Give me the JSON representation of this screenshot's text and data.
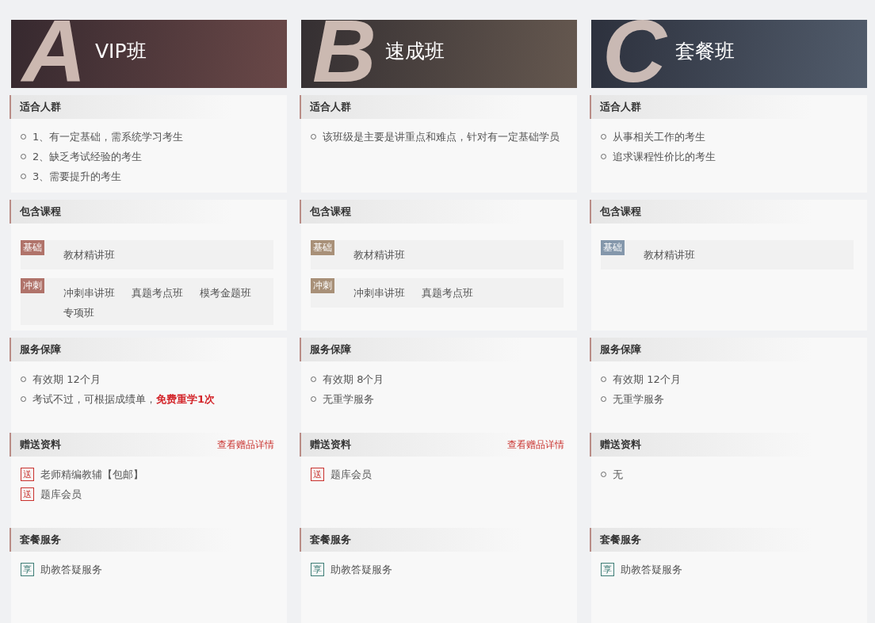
{
  "plans": [
    {
      "letter": "A",
      "title": "VIP班",
      "color": "#b0736a",
      "audience": {
        "heading": "适合人群",
        "items": [
          "1、有一定基础，需系统学习考生",
          "2、缺乏考试经验的考生",
          "3、需要提升的考生"
        ]
      },
      "courses": {
        "heading": "包含课程",
        "groups": [
          {
            "tag": "基础",
            "courses": [
              "教材精讲班"
            ]
          },
          {
            "tag": "冲刺",
            "courses": [
              "冲刺串讲班",
              "真题考点班",
              "模考金题班",
              "专项班"
            ]
          }
        ]
      },
      "service": {
        "heading": "服务保障",
        "items": [
          "有效期 12个月",
          "考试不过，可根据成绩单，**免费重学1次**"
        ]
      },
      "gifts": {
        "heading": "赠送资料",
        "link": "查看赠品详情",
        "items": [
          {
            "kind": "gift",
            "badge": "送",
            "text": "老师精编教辅【包邮】"
          },
          {
            "kind": "gift",
            "badge": "送",
            "text": "题库会员"
          }
        ]
      },
      "package": {
        "heading": "套餐服务",
        "items": [
          {
            "kind": "share",
            "badge": "享",
            "text": "助教答疑服务"
          }
        ]
      }
    },
    {
      "letter": "B",
      "title": "速成班",
      "color": "#a89078",
      "audience": {
        "heading": "适合人群",
        "items": [
          "该班级是主要是讲重点和难点，针对有一定基础学员"
        ]
      },
      "courses": {
        "heading": "包含课程",
        "groups": [
          {
            "tag": "基础",
            "courses": [
              "教材精讲班"
            ]
          },
          {
            "tag": "冲刺",
            "courses": [
              "冲刺串讲班",
              "真题考点班"
            ]
          }
        ]
      },
      "service": {
        "heading": "服务保障",
        "items": [
          "有效期 8个月",
          "无重学服务"
        ]
      },
      "gifts": {
        "heading": "赠送资料",
        "link": "查看赠品详情",
        "items": [
          {
            "kind": "gift",
            "badge": "送",
            "text": "题库会员"
          }
        ]
      },
      "package": {
        "heading": "套餐服务",
        "items": [
          {
            "kind": "share",
            "badge": "享",
            "text": "助教答疑服务"
          }
        ]
      }
    },
    {
      "letter": "C",
      "title": "套餐班",
      "color": "#8497ab",
      "audience": {
        "heading": "适合人群",
        "items": [
          "从事相关工作的考生",
          "追求课程性价比的考生"
        ]
      },
      "courses": {
        "heading": "包含课程",
        "groups": [
          {
            "tag": "基础",
            "courses": [
              "教材精讲班"
            ]
          }
        ]
      },
      "service": {
        "heading": "服务保障",
        "items": [
          "有效期 12个月",
          "无重学服务"
        ]
      },
      "gifts": {
        "heading": "赠送资料",
        "items": [
          {
            "kind": "bullet",
            "text": "无"
          }
        ]
      },
      "package": {
        "heading": "套餐服务",
        "items": [
          {
            "kind": "share",
            "badge": "享",
            "text": "助教答疑服务"
          }
        ]
      }
    }
  ]
}
